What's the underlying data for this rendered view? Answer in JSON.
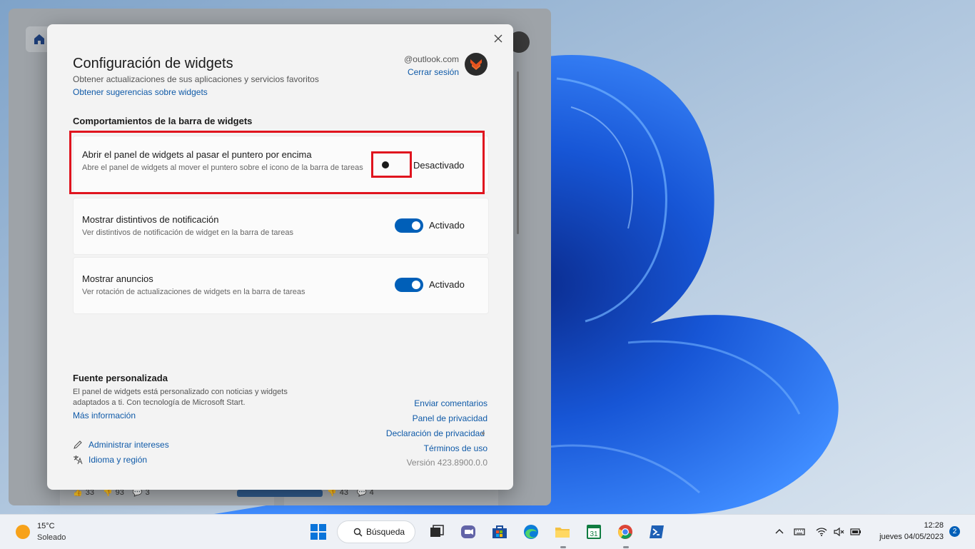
{
  "dialog": {
    "title": "Configuración de widgets",
    "subtitle": "Obtener actualizaciones de sus aplicaciones y servicios favoritos",
    "suggestions_link": "Obtener sugerencias sobre widgets",
    "account_email": "@outlook.com",
    "sign_out": "Cerrar sesión",
    "section_heading": "Comportamientos de la barra de widgets",
    "settings": [
      {
        "title": "Abrir el panel de widgets al pasar el puntero por encima",
        "description": "Abre el panel de widgets al mover el puntero sobre el icono de la barra de tareas",
        "state": "Desactivado",
        "enabled": false
      },
      {
        "title": "Mostrar distintivos de notificación",
        "description": "Ver distintivos de notificación de widget en la barra de tareas",
        "state": "Activado",
        "enabled": true
      },
      {
        "title": "Mostrar anuncios",
        "description": "Ver rotación de actualizaciones de widgets en la barra de tareas",
        "state": "Activado",
        "enabled": true
      }
    ],
    "feed": {
      "heading": "Fuente personalizada",
      "description": "El panel de widgets está personalizado con noticias y widgets adaptados a ti. Con tecnología de Microsoft Start.",
      "more_info": "Más información",
      "manage_interests": "Administrar intereses",
      "language_region": "Idioma y región"
    },
    "footer_links": {
      "feedback": "Enviar comentarios",
      "privacy_panel": "Panel de privacidad",
      "privacy_statement": "Declaración de privacidad",
      "terms": "Términos de uso",
      "version": "Versión 423.8900.0.0"
    }
  },
  "board": {
    "reactions_a": [
      "33",
      "93",
      "3"
    ],
    "reactions_b": [
      "43",
      "4"
    ]
  },
  "taskbar": {
    "weather_temp": "15°C",
    "weather_condition": "Soleado",
    "search_label": "Búsqueda",
    "calendar_day": "31",
    "clock_time": "12:28",
    "clock_date": "jueves 04/05/2023",
    "notification_count": "2"
  },
  "colors": {
    "accent": "#005fb8",
    "link": "#0f5aa8",
    "highlight": "#e0141e"
  }
}
